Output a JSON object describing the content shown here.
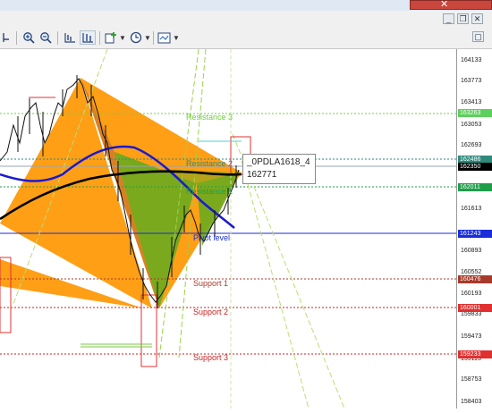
{
  "window": {
    "close_symbol": "✕",
    "restore_symbol": "❐",
    "minimize_symbol": "_",
    "panel_close_symbol": "✕",
    "panel_restore_symbol": "▢"
  },
  "toolbar": {
    "icons": [
      "cursor-icon",
      "zoom-in-icon",
      "zoom-out-icon",
      "chart-bar-icon",
      "chart-candle-icon",
      "add-indicator-icon",
      "clock-period-icon",
      "template-icon"
    ]
  },
  "levels": {
    "resistance3": "Resistance 3",
    "resistance2": "Resistance 2",
    "resistance1": "Resistance 1",
    "pivot": "Pivot level",
    "support1": "Support 1",
    "support2": "Support 2",
    "support3": "Support 3"
  },
  "tooltip": {
    "name": "_0PDLA1618_4",
    "value": "162771"
  },
  "axis": {
    "ticks": [
      "164133",
      "163773",
      "163413",
      "163053",
      "162693",
      "161973",
      "161613",
      "160893",
      "160552",
      "160193",
      "159833",
      "159473",
      "159113",
      "158753",
      "158403"
    ],
    "price_tags": [
      {
        "label": "163263",
        "color": "#5ccf5c"
      },
      {
        "label": "162486",
        "color": "#2f8a7c"
      },
      {
        "label": "162350",
        "color": "#000000"
      },
      {
        "label": "162011",
        "color": "#1f9e4a"
      },
      {
        "label": "161243",
        "color": "#1a2dd8"
      },
      {
        "label": "160476",
        "color": "#a83a2a"
      },
      {
        "label": "160001",
        "color": "#e03030"
      },
      {
        "label": "159233",
        "color": "#e03030"
      }
    ]
  },
  "colors": {
    "orange_pattern": "#ff9a0a",
    "green_pattern": "#6caa1e",
    "ma_black": "#000000",
    "ma_blue": "#1a1ad0",
    "resistance": "#6ed23c",
    "support": "#cc1f1f"
  }
}
